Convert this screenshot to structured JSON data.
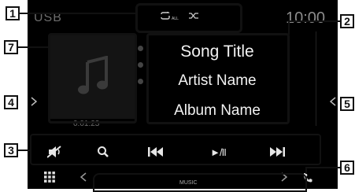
{
  "header": {
    "source": "USB",
    "repeat_icon_label": "ALL",
    "clock": "10:00"
  },
  "track": {
    "title": "Song Title",
    "artist": "Artist Name",
    "album": "Album Name",
    "elapsed": "0:01:23"
  },
  "controls": {
    "mute_icon": "speaker-muted-icon",
    "search_icon": "search-icon",
    "prev_icon": "skip-previous-icon",
    "playpause_label": "►/II",
    "next_icon": "skip-next-icon"
  },
  "footer": {
    "source_tab_label": "MUSIC"
  },
  "callouts": [
    "1",
    "2",
    "3",
    "4",
    "5",
    "6",
    "7"
  ],
  "colors": {
    "screen": "#000000",
    "outline": "#111111"
  }
}
